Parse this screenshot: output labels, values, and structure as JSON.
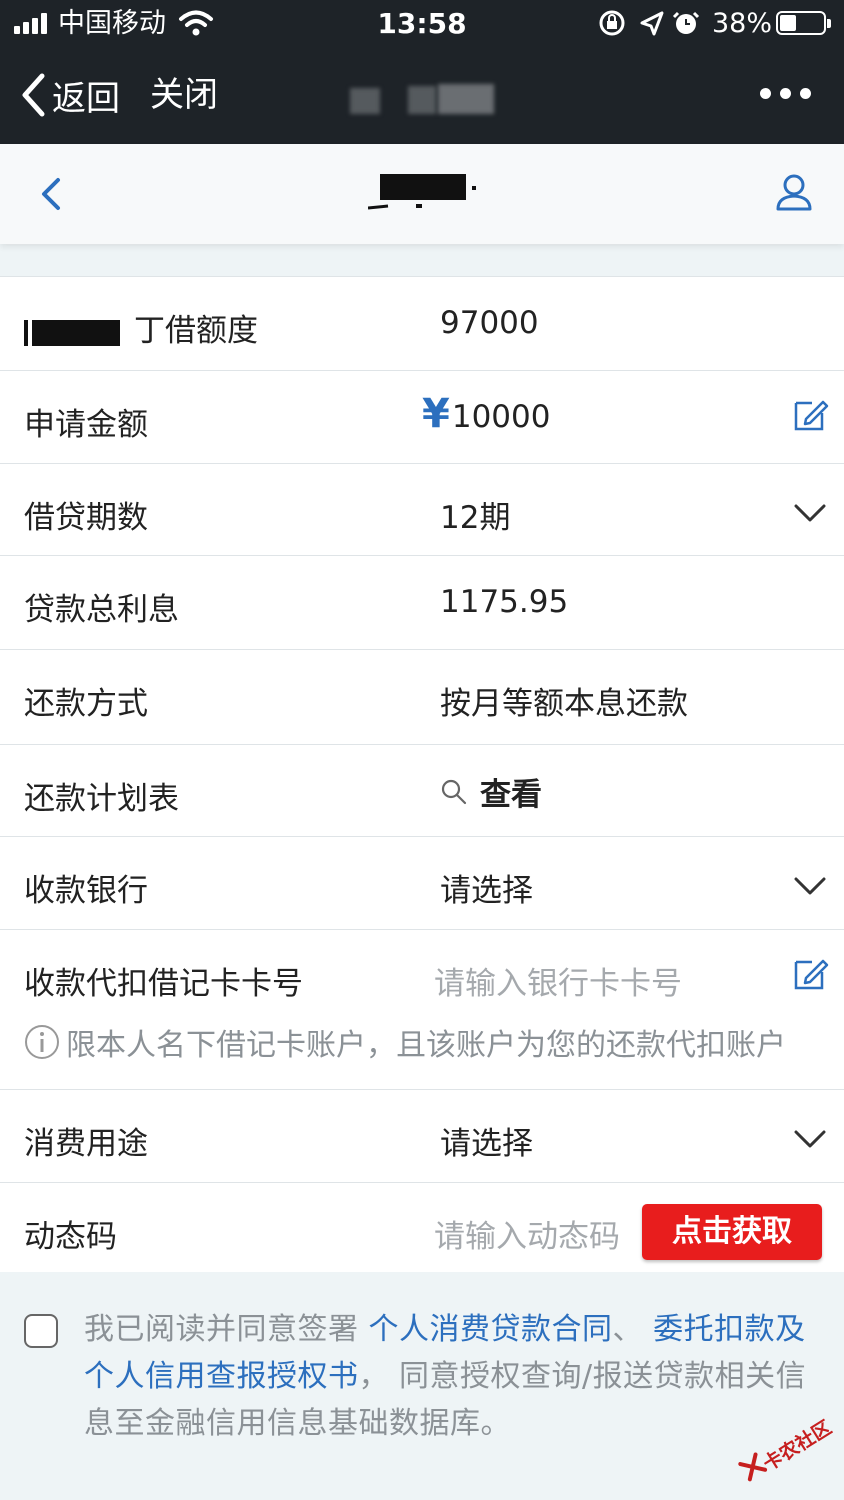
{
  "status_bar": {
    "carrier": "中国移动",
    "time": "13:58",
    "battery_pct": "38%",
    "battery_level": 0.38
  },
  "nav": {
    "back_label": "返回",
    "close_label": "关闭"
  },
  "form": {
    "credit_limit": {
      "label_suffix": "丁借额度",
      "value": "97000"
    },
    "apply_amount": {
      "label": "申请金额",
      "currency": "¥",
      "value": "10000"
    },
    "loan_term": {
      "label": "借贷期数",
      "value": "12期"
    },
    "total_interest": {
      "label": "贷款总利息",
      "value": "1175.95"
    },
    "repay_method": {
      "label": "还款方式",
      "value": "按月等额本息还款"
    },
    "repay_schedule": {
      "label": "还款计划表",
      "value": "查看"
    },
    "receiving_bank": {
      "label": "收款银行",
      "value": "请选择"
    },
    "debit_card": {
      "label": "收款代扣借记卡卡号",
      "placeholder": "请输入银行卡卡号",
      "note": "限本人名下借记卡账户，且该账户为您的还款代扣账户"
    },
    "purpose": {
      "label": "消费用途",
      "value": "请选择"
    },
    "dynamic_code": {
      "label": "动态码",
      "placeholder": "请输入动态码",
      "button": "点击获取"
    }
  },
  "agreement": {
    "prefix": "我已阅读并同意签署 ",
    "link1": "个人消费贷款合同",
    "sep": "、 ",
    "link2": "委托扣款及个人信用查报授权书",
    "suffix": "， 同意授权查询/报送贷款相关信息至金融信用信息基础数据库。"
  },
  "watermark": {
    "text": "卡农社区"
  },
  "colors": {
    "accent": "#2c6fbe",
    "button": "#e81d1d",
    "dark_bar": "#1e2328"
  }
}
